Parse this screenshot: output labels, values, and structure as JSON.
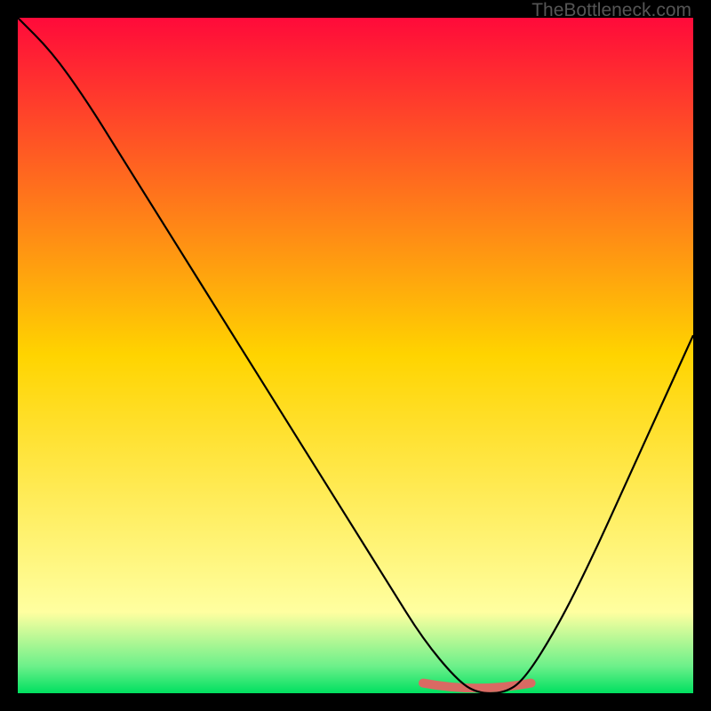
{
  "watermark": "TheBottleneck.com",
  "chart_data": {
    "type": "line",
    "title": "",
    "xlabel": "",
    "ylabel": "",
    "xlim": [
      0,
      100
    ],
    "ylim": [
      0,
      100
    ],
    "background_gradient": {
      "stops": [
        {
          "offset": 0,
          "color": "#ff0a3a"
        },
        {
          "offset": 50,
          "color": "#ffd400"
        },
        {
          "offset": 88,
          "color": "#ffffa0"
        },
        {
          "offset": 96,
          "color": "#6cf08a"
        },
        {
          "offset": 100,
          "color": "#00e060"
        }
      ]
    },
    "series": [
      {
        "name": "bottleneck-curve",
        "x": [
          0,
          5,
          10,
          15,
          20,
          25,
          30,
          35,
          40,
          45,
          50,
          55,
          60,
          65,
          68,
          72,
          75,
          80,
          85,
          90,
          95,
          100
        ],
        "y": [
          100,
          95,
          88,
          80,
          72,
          64,
          56,
          48,
          40,
          32,
          24,
          16,
          8,
          2,
          0,
          0,
          2,
          10,
          20,
          31,
          42,
          53
        ],
        "color": "#000000",
        "width": 2.2
      }
    ],
    "sweet_spot_marker": {
      "x_range": [
        60,
        76
      ],
      "y": 1.5,
      "color": "#d96a63",
      "width": 10
    }
  }
}
